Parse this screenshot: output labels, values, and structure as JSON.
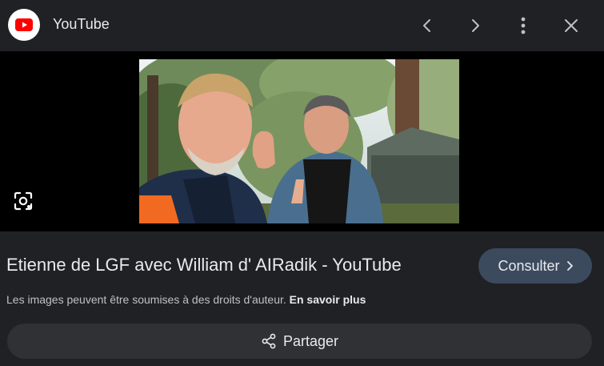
{
  "header": {
    "site_name": "YouTube",
    "icons": [
      "youtube-icon",
      "chevron-left-icon",
      "chevron-right-icon",
      "more-vert-icon",
      "close-icon"
    ]
  },
  "media": {
    "lens_icon": "lens-search-icon"
  },
  "result": {
    "title": "Etienne de LGF avec William d' AIRadik - YouTube",
    "visit_label": "Consulter",
    "copyright_notice": "Les images peuvent être soumises à des droits d'auteur.",
    "learn_more_label": "En savoir plus",
    "share_label": "Partager"
  },
  "colors": {
    "background": "#202124",
    "visit_button": "#3c4a5e",
    "share_button": "#303134",
    "youtube_red": "#ff0000"
  }
}
